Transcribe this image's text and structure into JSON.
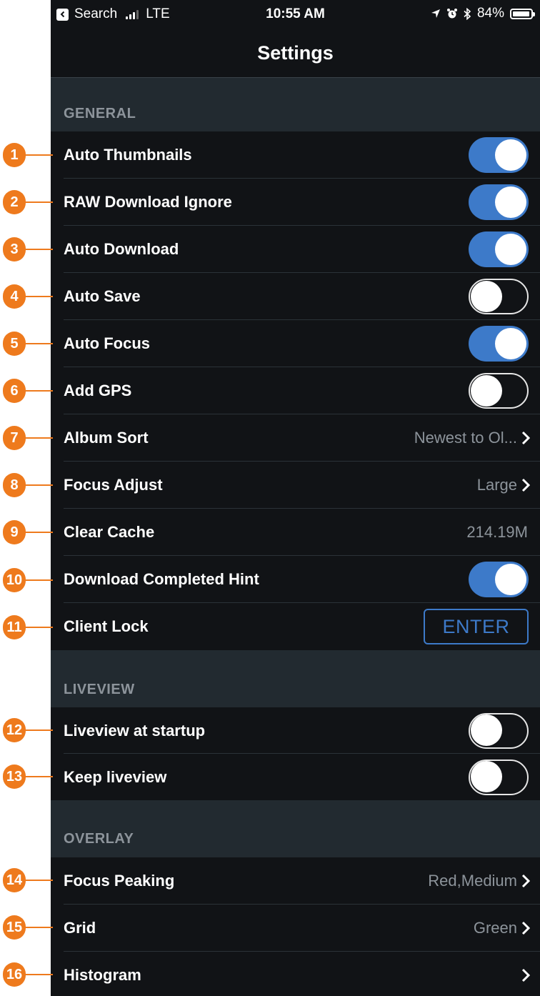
{
  "status_bar": {
    "back_label": "Search",
    "carrier": "LTE",
    "time": "10:55 AM",
    "battery": "84%"
  },
  "nav": {
    "title": "Settings"
  },
  "sections": {
    "general": {
      "header": "GENERAL",
      "rows": [
        {
          "label": "Auto Thumbnails",
          "toggle": true
        },
        {
          "label": "RAW Download Ignore",
          "toggle": true
        },
        {
          "label": "Auto Download",
          "toggle": true
        },
        {
          "label": "Auto Save",
          "toggle": false
        },
        {
          "label": "Auto Focus",
          "toggle": true
        },
        {
          "label": "Add GPS",
          "toggle": false
        },
        {
          "label": "Album Sort",
          "value": "Newest to Ol..."
        },
        {
          "label": "Focus Adjust",
          "value": "Large"
        },
        {
          "label": "Clear Cache",
          "value": "214.19M"
        },
        {
          "label": "Download Completed Hint",
          "toggle": true
        },
        {
          "label": "Client Lock",
          "button": "ENTER"
        }
      ]
    },
    "liveview": {
      "header": "LIVEVIEW",
      "rows": [
        {
          "label": "Liveview at startup",
          "toggle": false
        },
        {
          "label": "Keep liveview",
          "toggle": false
        }
      ]
    },
    "overlay": {
      "header": "OVERLAY",
      "rows": [
        {
          "label": "Focus Peaking",
          "value": "Red,Medium"
        },
        {
          "label": "Grid",
          "value": "Green"
        },
        {
          "label": "Histogram",
          "value": ""
        }
      ]
    }
  },
  "callouts": [
    "1",
    "2",
    "3",
    "4",
    "5",
    "6",
    "7",
    "8",
    "9",
    "10",
    "11",
    "12",
    "13",
    "14",
    "15",
    "16"
  ],
  "colors": {
    "accent": "#3d7ac9",
    "callout": "#ee7a1d",
    "row_bg": "#111316",
    "section_bg": "#222a30"
  }
}
